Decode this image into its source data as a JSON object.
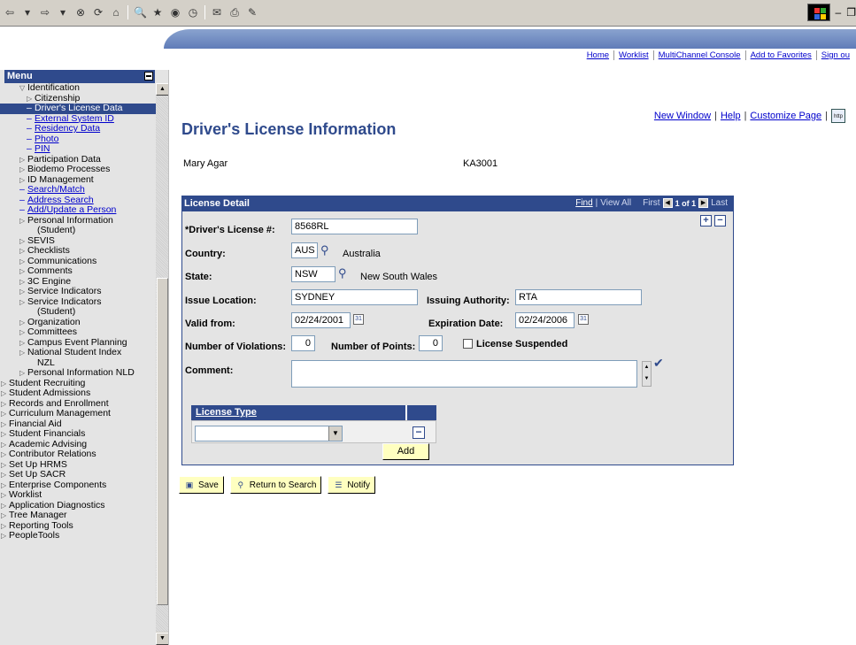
{
  "colors": {
    "accent": "#2f4a8c",
    "menu_bg": "#e4e4e4",
    "button_bg": "#ffffc0",
    "link": "#0000cc"
  },
  "header": {
    "nav": [
      "Home",
      "Worklist",
      "MultiChannel Console",
      "Add to Favorites",
      "Sign ou"
    ]
  },
  "menu": {
    "title": "Menu",
    "items": [
      {
        "label": "Identification",
        "level": 1,
        "icon": "expanded-triangle-icon"
      },
      {
        "label": "Citizenship",
        "level": 2,
        "icon": "collapsed-triangle-icon"
      },
      {
        "label": "Driver's License Data",
        "level": 2,
        "selected": true
      },
      {
        "label": "External System ID",
        "level": 2,
        "link": true
      },
      {
        "label": "Residency Data",
        "level": 2,
        "link": true
      },
      {
        "label": "Photo",
        "level": 2,
        "link": true
      },
      {
        "label": "PIN",
        "level": 2,
        "link": true
      },
      {
        "label": "Participation Data",
        "level": 1
      },
      {
        "label": "Biodemo Processes",
        "level": 1
      },
      {
        "label": "ID Management",
        "level": 1
      },
      {
        "label": "Search/Match",
        "level": 1,
        "link": true
      },
      {
        "label": "Address Search",
        "level": 1,
        "link": true
      },
      {
        "label": "Add/Update a Person",
        "level": 1,
        "link": true
      },
      {
        "label": "Personal Information",
        "label2": "(Student)",
        "level": 1
      },
      {
        "label": "SEVIS",
        "level": 1
      },
      {
        "label": "Checklists",
        "level": 1
      },
      {
        "label": "Communications",
        "level": 1
      },
      {
        "label": "Comments",
        "level": 1
      },
      {
        "label": "3C Engine",
        "level": 1
      },
      {
        "label": "Service Indicators",
        "level": 1
      },
      {
        "label": "Service Indicators",
        "label2": "(Student)",
        "level": 1
      },
      {
        "label": "Organization",
        "level": 1
      },
      {
        "label": "Committees",
        "level": 1
      },
      {
        "label": "Campus Event Planning",
        "level": 1
      },
      {
        "label": "National Student Index",
        "label2": "NZL",
        "level": 1
      },
      {
        "label": "Personal Information NLD",
        "level": 1
      },
      {
        "label": "Student Recruiting",
        "level": 0
      },
      {
        "label": "Student Admissions",
        "level": 0
      },
      {
        "label": "Records and Enrollment",
        "level": 0
      },
      {
        "label": "Curriculum Management",
        "level": 0
      },
      {
        "label": "Financial Aid",
        "level": 0
      },
      {
        "label": "Student Financials",
        "level": 0
      },
      {
        "label": "Academic Advising",
        "level": 0
      },
      {
        "label": "Contributor Relations",
        "level": 0
      },
      {
        "label": "Set Up HRMS",
        "level": 0
      },
      {
        "label": "Set Up SACR",
        "level": 0
      },
      {
        "label": "Enterprise Components",
        "level": 0
      },
      {
        "label": "Worklist",
        "level": 0
      },
      {
        "label": "Application Diagnostics",
        "level": 0
      },
      {
        "label": "Tree Manager",
        "level": 0
      },
      {
        "label": "Reporting Tools",
        "level": 0
      },
      {
        "label": "PeopleTools",
        "level": 0
      }
    ]
  },
  "top_links": {
    "new_window": "New Window",
    "help": "Help",
    "customize": "Customize Page",
    "sep": "|",
    "http_icon_text": "http"
  },
  "page": {
    "title": "Driver's License Information",
    "person_name": "Mary Agar",
    "person_id": "KA3001"
  },
  "license_detail": {
    "title": "License Detail",
    "nav": {
      "find": "Find",
      "sep": "|",
      "view_all": "View All",
      "first": "First",
      "count": "1 of 1",
      "last": "Last"
    },
    "fields": {
      "license_label": "*Driver's License #:",
      "license_value": "8568RL",
      "country_label": "Country:",
      "country_value": "AUS",
      "country_desc": "Australia",
      "state_label": "State:",
      "state_value": "NSW",
      "state_desc": "New South Wales",
      "issue_location_label": "Issue Location:",
      "issue_location_value": "SYDNEY",
      "issuing_authority_label": "Issuing Authority:",
      "issuing_authority_value": "RTA",
      "valid_from_label": "Valid from:",
      "valid_from_value": "02/24/2001",
      "expiration_label": "Expiration Date:",
      "expiration_value": "02/24/2006",
      "violations_label": "Number of Violations:",
      "violations_value": "0",
      "points_label": "Number of Points:",
      "points_value": "0",
      "suspended_label": "License Suspended",
      "comment_label": "Comment:"
    },
    "license_type": {
      "header": "License Type",
      "selected": "",
      "add_label": "Add"
    }
  },
  "actions": {
    "save": "Save",
    "return_to_search": "Return to Search",
    "notify": "Notify"
  }
}
